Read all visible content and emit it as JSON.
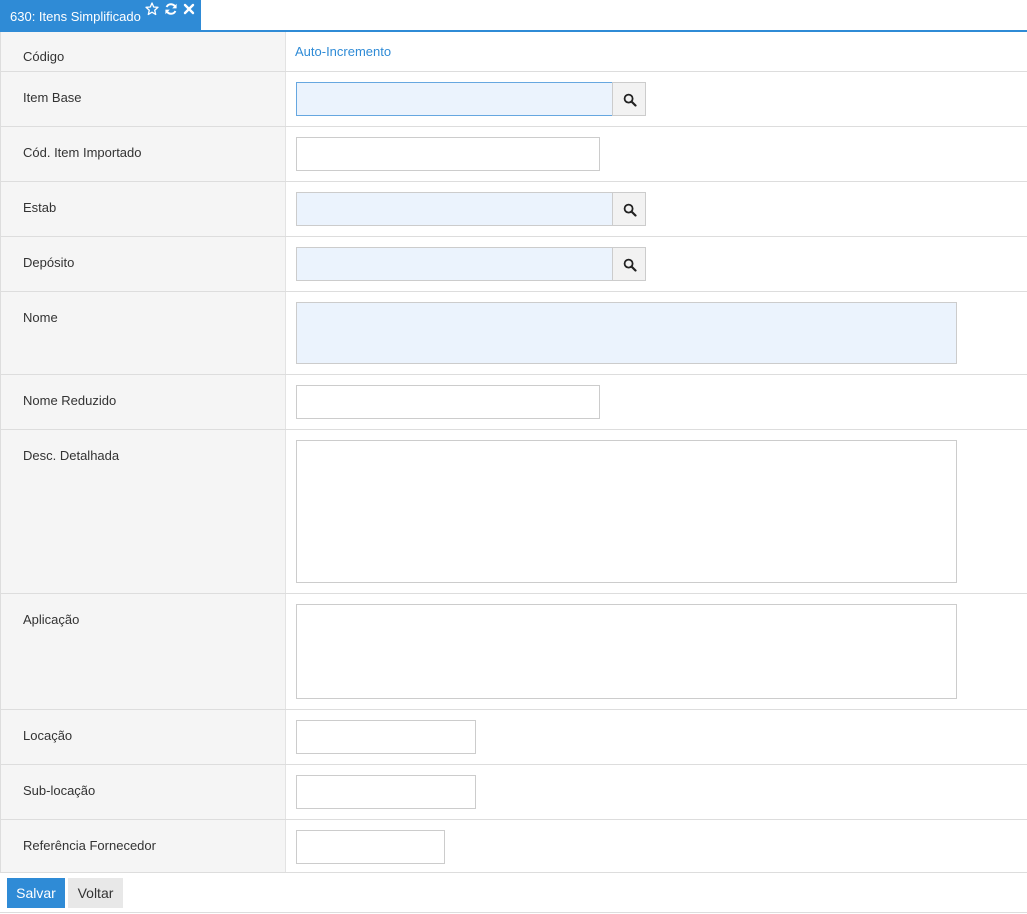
{
  "tab": {
    "title": "630: Itens Simplificado"
  },
  "rows": [
    {
      "label": "Código",
      "value": "Auto-Incremento"
    },
    {
      "label": "Item Base"
    },
    {
      "label": "Cód. Item Importado"
    },
    {
      "label": "Estab"
    },
    {
      "label": "Depósito"
    },
    {
      "label": "Nome"
    },
    {
      "label": "Nome Reduzido"
    },
    {
      "label": "Desc. Detalhada"
    },
    {
      "label": "Aplicação"
    },
    {
      "label": "Locação"
    },
    {
      "label": "Sub-locação"
    },
    {
      "label": "Referência Fornecedor"
    }
  ],
  "footer": {
    "save_label": "Salvar",
    "back_label": "Voltar"
  },
  "icons": {
    "favorite": "star-outline-icon",
    "refresh": "refresh-icon",
    "close": "close-icon",
    "lookup": "magnifier-icon"
  },
  "colors": {
    "accent": "#2f8bd6",
    "required_field": "#ebf3fd"
  }
}
